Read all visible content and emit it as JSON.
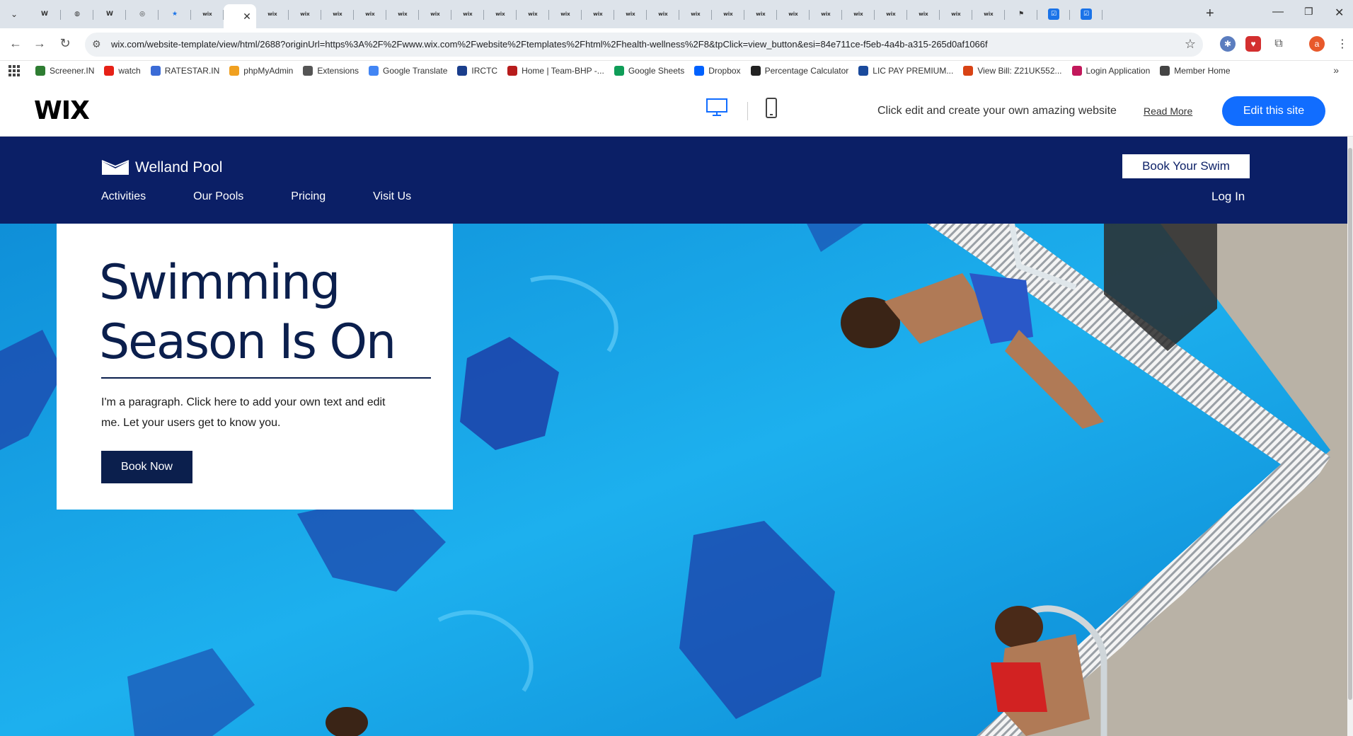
{
  "browser": {
    "active_tab_close": "✕",
    "new_tab": "+",
    "url": "wix.com/website-template/view/html/2688?originUrl=https%3A%2F%2Fwww.wix.com%2Fwebsite%2Ftemplates%2Fhtml%2Fhealth-wellness%2F8&tpClick=view_button&esi=84e711ce-f5eb-4a4b-a315-265d0af1066f",
    "profile_initial": "a"
  },
  "bookmarks": [
    {
      "label": "Screener.IN",
      "color": "#2e7d32"
    },
    {
      "label": "watch",
      "color": "#e62117"
    },
    {
      "label": "RATESTAR.IN",
      "color": "#3b6bd6"
    },
    {
      "label": "phpMyAdmin",
      "color": "#f0a020"
    },
    {
      "label": "Extensions",
      "color": "#555555"
    },
    {
      "label": "Google Translate",
      "color": "#4285f4"
    },
    {
      "label": "IRCTC",
      "color": "#1a3e8c"
    },
    {
      "label": "Home | Team-BHP -...",
      "color": "#b71c1c"
    },
    {
      "label": "Google Sheets",
      "color": "#0f9d58"
    },
    {
      "label": "Dropbox",
      "color": "#0061fe"
    },
    {
      "label": "Percentage Calculator",
      "color": "#222222"
    },
    {
      "label": "LIC PAY PREMIUM...",
      "color": "#1a4a9c"
    },
    {
      "label": "View Bill: Z21UK552...",
      "color": "#d84315"
    },
    {
      "label": "Login Application",
      "color": "#c2185b"
    },
    {
      "label": "Member Home",
      "color": "#444444"
    }
  ],
  "wix_banner": {
    "logo": "WIX",
    "message": "Click edit and create your own amazing website",
    "read_more": "Read More",
    "edit_button": "Edit this site"
  },
  "site": {
    "brand": "Welland Pool",
    "nav": [
      "Activities",
      "Our Pools",
      "Pricing",
      "Visit Us"
    ],
    "book_swim": "Book Your Swim",
    "login": "Log In",
    "hero": {
      "title": "Swimming Season Is On",
      "paragraph": "I'm a paragraph. Click here to add your own text and edit me. Let your users get to know you.",
      "button": "Book Now"
    },
    "colors": {
      "navy": "#0b1f66",
      "pool": "#1aa3e8",
      "wix_blue": "#116dff"
    }
  }
}
